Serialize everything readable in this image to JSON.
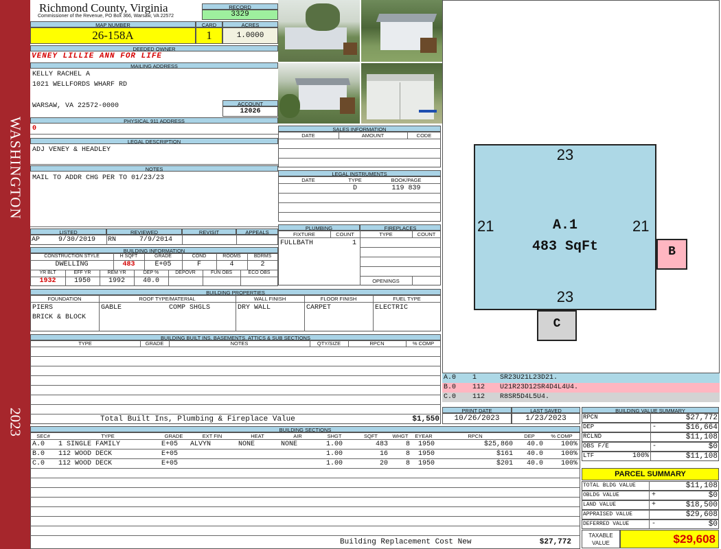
{
  "side_banner": {
    "district": "WASHINGTON",
    "year": "2023"
  },
  "header": {
    "county": "Richmond County, Virginia",
    "commissioner": "Commissioner of the Revenue, PO Box 366, Warsaw, VA 22572",
    "record_label": "RECORD",
    "record": "3329",
    "map_label": "MAP NUMBER",
    "map_number": "26-158A",
    "card_label": "CARD",
    "card": "1",
    "acres_label": "ACRES",
    "acres": "1.0000"
  },
  "owner": {
    "deeded_label": "DEEDED OWNER",
    "deeded_owner": "VENEY LILLIE ANN FOR LIFE",
    "mailing_label": "MAILING ADDRESS",
    "mailing_lines": [
      "KELLY RACHEL A",
      "1021 WELLFORDS WHARF RD",
      "WARSAW, VA 22572-0000"
    ],
    "account_label": "ACCOUNT",
    "account": "12026",
    "physical_label": "PHYSICAL 911 ADDRESS",
    "physical": "0",
    "legal_label": "LEGAL DESCRIPTION",
    "legal": "ADJ VENEY & HEADLEY",
    "notes_label": "NOTES",
    "notes": "MAIL TO ADDR CHG PER TO 01/23/23"
  },
  "listing": {
    "listed_label": "LISTED",
    "reviewed_label": "REVIEWED",
    "revisit_label": "REVISIT",
    "appeals_label": "APPEALS",
    "listed_by": "AP",
    "listed_date": "9/30/2019",
    "reviewed_by": "RN",
    "reviewed_date": "7/9/2014"
  },
  "building_info": {
    "label": "BUILDING INFORMATION",
    "h_cs": "CONSTRUCTION STYLE",
    "h_hsqft": "H SQFT",
    "h_grade": "GRADE",
    "h_cond": "COND",
    "h_rooms": "ROOMS",
    "h_bdrms": "BDRMS",
    "cs": "DWELLING",
    "hsqft": "483",
    "grade": "E+05",
    "cond": "F",
    "rooms": "4",
    "bdrms": "2",
    "h_yrblt": "YR BLT",
    "h_effyr": "EFF YR",
    "h_remyr": "REM YR",
    "h_dep": "DEP %",
    "h_depovr": "DEPOVR",
    "h_funobs": "FUN OBS",
    "h_ecoobs": "ECO OBS",
    "yrblt": "1932",
    "effyr": "1950",
    "remyr": "1992",
    "dep": "40.0"
  },
  "sales": {
    "label": "SALES INFORMATION",
    "h_date": "DATE",
    "h_amount": "AMOUNT",
    "h_code": "CODE"
  },
  "legal_instruments": {
    "label": "LEGAL INSTRUMENTS",
    "h_date": "DATE",
    "h_type": "TYPE",
    "h_book": "BOOK/PAGE",
    "type": "D",
    "book": "119 839"
  },
  "plumbing": {
    "label": "PLUMBING",
    "h_fixture": "FIXTURE",
    "h_count": "COUNT",
    "fixture": "FULLBATH",
    "count": "1"
  },
  "fireplaces": {
    "label": "FIREPLACES",
    "h_type": "TYPE",
    "h_count": "COUNT",
    "openings": "OPENINGS"
  },
  "properties": {
    "label": "BUILDING PROPERTIES",
    "h_foundation": "FOUNDATION",
    "h_roof": "ROOF TYPE/MATERIAL",
    "h_wall": "WALL FINISH",
    "h_floor": "FLOOR FINISH",
    "h_fuel": "FUEL TYPE",
    "foundation": [
      "PIERS",
      "BRICK & BLOCK"
    ],
    "roof_type": "GABLE",
    "roof_material": "COMP SHGLS",
    "wall": "DRY WALL",
    "floor": "CARPET",
    "fuel": "ELECTRIC"
  },
  "builtins": {
    "label": "BUILDING BUILT INS, BASEMENTS, ATTICS & SUB SECTIONS",
    "h_type": "TYPE",
    "h_grade": "GRADE",
    "h_notes": "NOTES",
    "h_qty": "QTY/SIZE",
    "h_rpcn": "RPCN",
    "h_comp": "% COMP",
    "total_label": "Total Built Ins, Plumbing & Fireplace Value",
    "total": "$1,550"
  },
  "sketch": {
    "main_label": "A.1",
    "main_area": "483 SqFt",
    "top": "23",
    "bottom": "23",
    "left": "21",
    "right": "21",
    "b": "B",
    "c": "C",
    "vectors": [
      {
        "id": "A.0",
        "code": "1",
        "path": "SR23U21L23D21."
      },
      {
        "id": "B.0",
        "code": "112",
        "path": "U21R23D12SR4D4L4U4."
      },
      {
        "id": "C.0",
        "code": "112",
        "path": "R8SR5D4L5U4."
      }
    ]
  },
  "dates": {
    "print_label": "PRINT DATE",
    "saved_label": "LAST SAVED",
    "print": "10/26/2023",
    "saved": "1/23/2023"
  },
  "sections": {
    "label": "BUILDING SECTIONS",
    "headers": [
      "SEC#",
      "TYPE",
      "GRADE",
      "EXT FIN",
      "HEAT",
      "AIR",
      "SHGT",
      "SQFT",
      "WHGT",
      "EYEAR",
      "RPCN",
      "DEP",
      "% COMP"
    ],
    "rows": [
      [
        "A.0",
        "1 SINGLE FAMILY",
        "E+05",
        "ALVYN",
        "NONE",
        "NONE",
        "1.00",
        "483",
        "8",
        "1950",
        "$25,860",
        "40.0",
        "100%"
      ],
      [
        "B.0",
        "112 WOOD DECK",
        "E+05",
        "",
        "",
        "",
        "1.00",
        "16",
        "8",
        "1950",
        "$161",
        "40.0",
        "100%"
      ],
      [
        "C.0",
        "112 WOOD DECK",
        "E+05",
        "",
        "",
        "",
        "1.00",
        "20",
        "8",
        "1950",
        "$201",
        "40.0",
        "100%"
      ]
    ],
    "replacement_label": "Building Replacement Cost New",
    "replacement": "$27,772"
  },
  "value_summary": {
    "label": "BUILDING VALUE SUMMARY",
    "rows": [
      {
        "k": "RPCN",
        "op": "",
        "v": "$27,772"
      },
      {
        "k": "DEP",
        "op": "-",
        "v": "$16,664"
      },
      {
        "k": "RCLND",
        "op": "",
        "v": "$11,108"
      },
      {
        "k": "OBS F/E",
        "op": "-",
        "v": "$0"
      },
      {
        "k": "LTF",
        "op": "100%",
        "v": "$11,108"
      }
    ]
  },
  "parcel": {
    "label": "PARCEL SUMMARY",
    "rows": [
      {
        "k": "TOTAL BLDG VALUE",
        "op": "",
        "v": "$11,108"
      },
      {
        "k": "OBLDG VALUE",
        "op": "+",
        "v": "$0"
      },
      {
        "k": "LAND VALUE",
        "op": "+",
        "v": "$18,500"
      },
      {
        "k": "APPRAISED VALUE",
        "op": "",
        "v": "$29,608"
      },
      {
        "k": "DEFERRED VALUE",
        "op": "-",
        "v": "$0"
      }
    ],
    "taxable_label": "TAXABLE VALUE",
    "taxable": "$29,608"
  },
  "colors": {
    "banner": "#a6262c",
    "header_blue": "#a9d3e6",
    "yellow": "#ffff00",
    "record_green": "#9ef09e",
    "sketch_blue": "#add8e6",
    "pink": "#ffb6c1",
    "gray_box": "#d3d3d3"
  }
}
